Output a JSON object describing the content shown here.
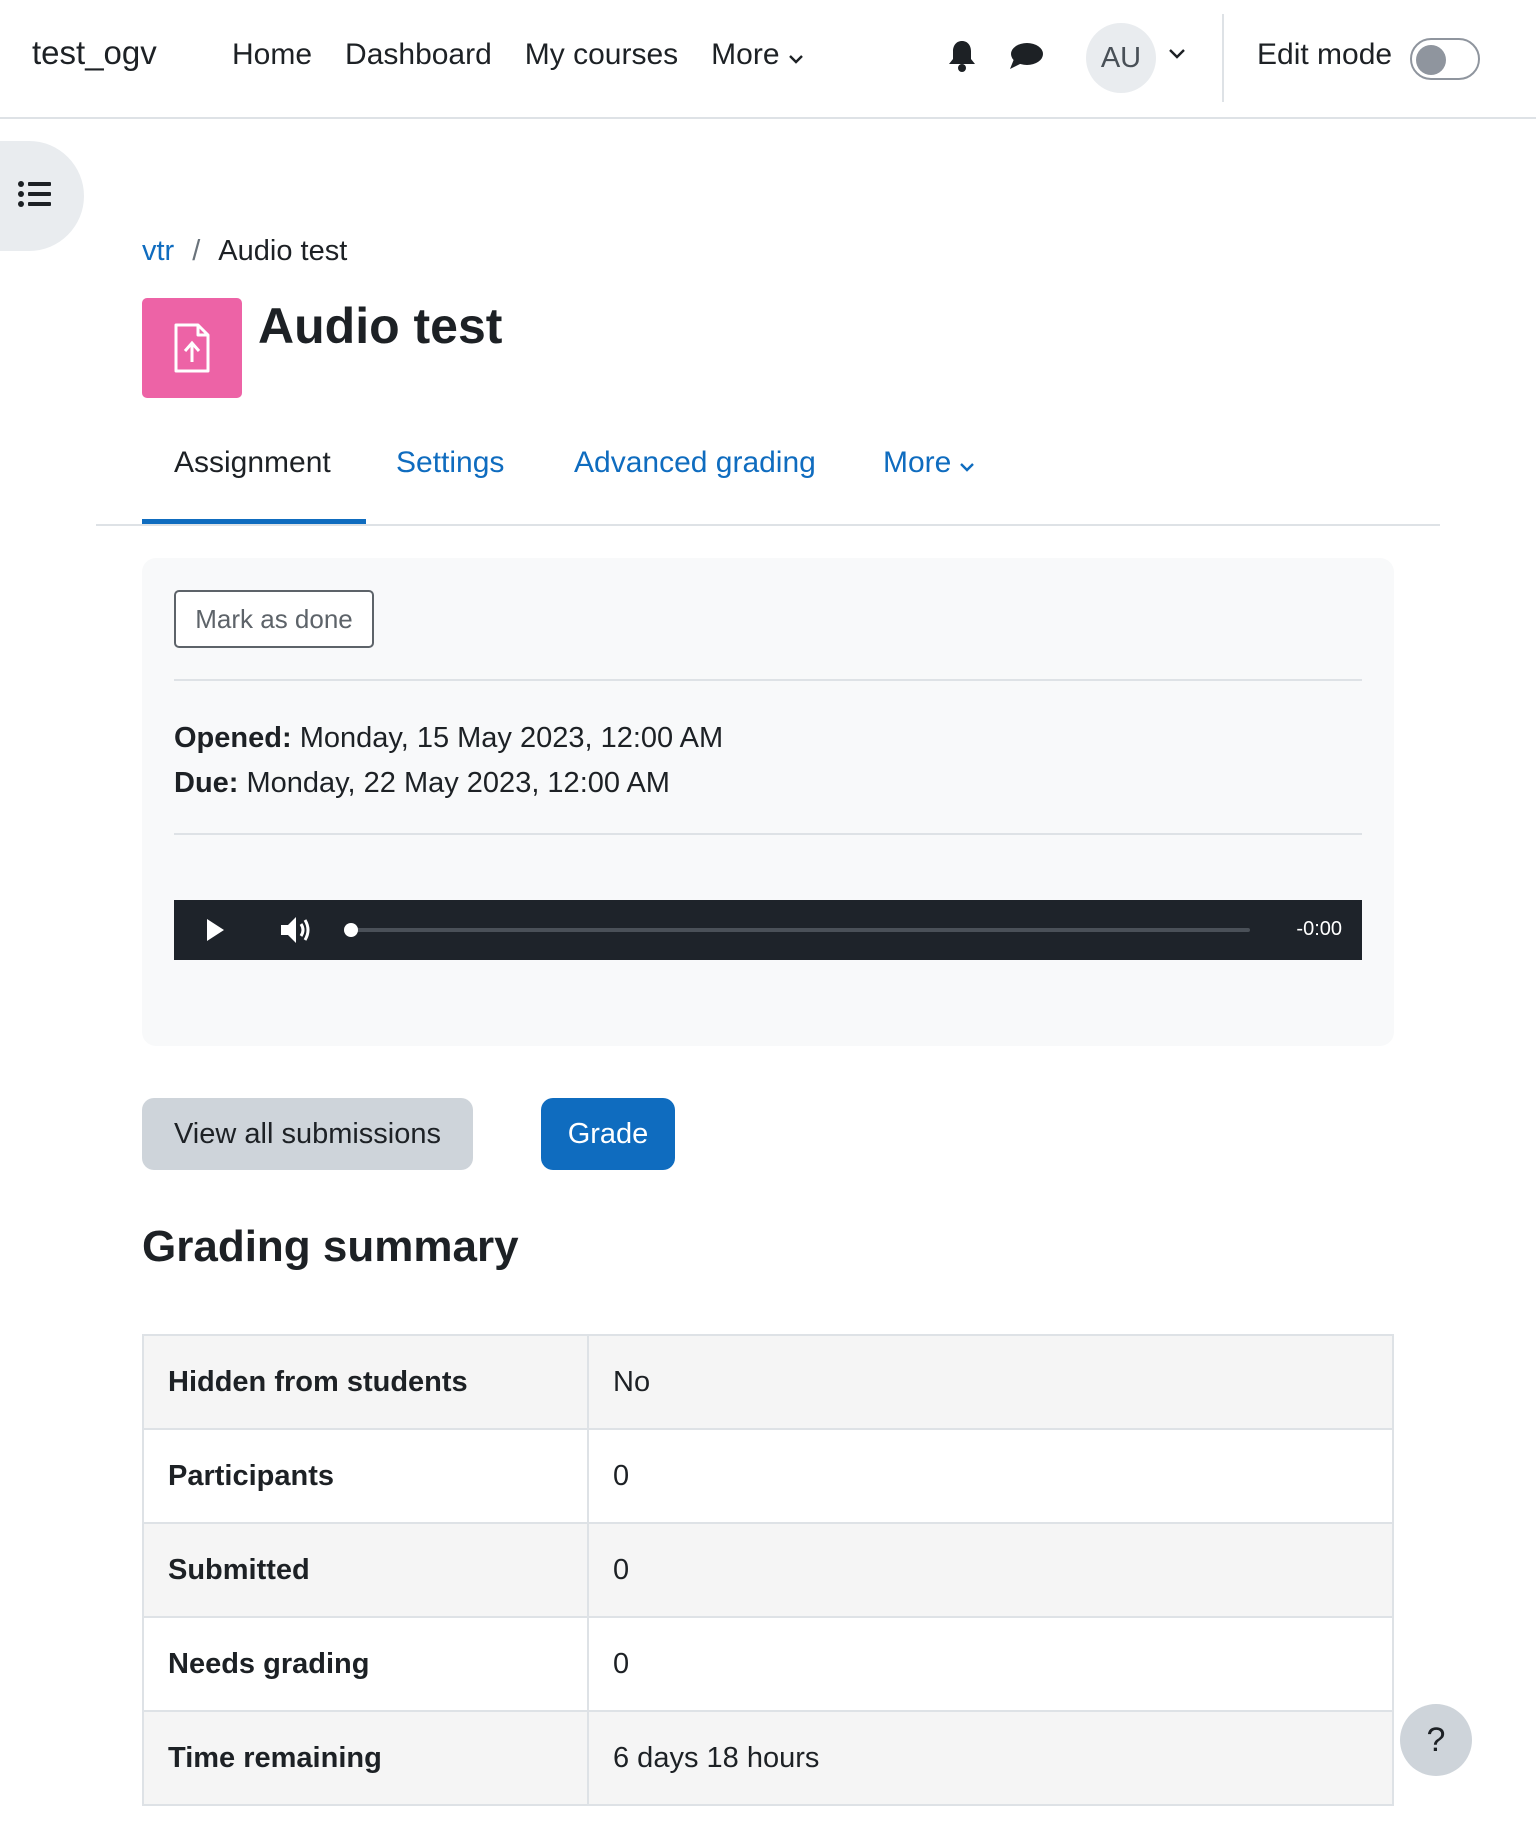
{
  "navbar": {
    "brand": "test_ogv",
    "items": [
      {
        "label": "Home"
      },
      {
        "label": "Dashboard"
      },
      {
        "label": "My courses"
      },
      {
        "label": "More"
      }
    ],
    "avatar_initials": "AU",
    "edit_mode_label": "Edit mode",
    "edit_mode_on": false
  },
  "breadcrumb": {
    "items": [
      {
        "label": "vtr"
      },
      {
        "label": "Audio test"
      }
    ],
    "separator": "/"
  },
  "page": {
    "title": "Audio test",
    "activity_icon": "assignment-upload-icon",
    "activity_icon_color": "#ed63a6"
  },
  "tabs": [
    {
      "label": "Assignment",
      "active": true
    },
    {
      "label": "Settings"
    },
    {
      "label": "Advanced grading"
    },
    {
      "label": "More"
    }
  ],
  "activity": {
    "mark_done_label": "Mark as done",
    "opened_label": "Opened:",
    "opened_value": "Monday, 15 May 2023, 12:00 AM",
    "due_label": "Due:",
    "due_value": "Monday, 22 May 2023, 12:00 AM",
    "audio_player": {
      "time": "-0:00",
      "progress": 0
    }
  },
  "actions": {
    "view_all_label": "View all submissions",
    "grade_label": "Grade"
  },
  "summary": {
    "heading": "Grading summary",
    "rows": [
      {
        "label": "Hidden from students",
        "value": "No"
      },
      {
        "label": "Participants",
        "value": "0"
      },
      {
        "label": "Submitted",
        "value": "0"
      },
      {
        "label": "Needs grading",
        "value": "0"
      },
      {
        "label": "Time remaining",
        "value": "6 days 18 hours"
      }
    ]
  },
  "help_label": "?",
  "colors": {
    "primary": "#0f6cbf",
    "text": "#1d2125",
    "activity_pink": "#ed63a6"
  }
}
